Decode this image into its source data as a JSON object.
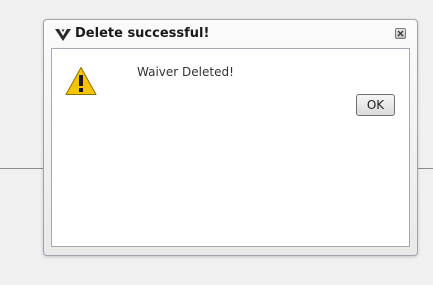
{
  "dialog": {
    "title": "Delete successful!",
    "title_icon": "air-force-wings-icon",
    "close_icon": "close-icon",
    "message_icon": "warning-icon",
    "message": "Waiver Deleted!",
    "ok_label": "OK"
  },
  "colors": {
    "warning_yellow": "#f5c400",
    "content_background": "#ffffff",
    "page_background": "#f0f0f0"
  }
}
